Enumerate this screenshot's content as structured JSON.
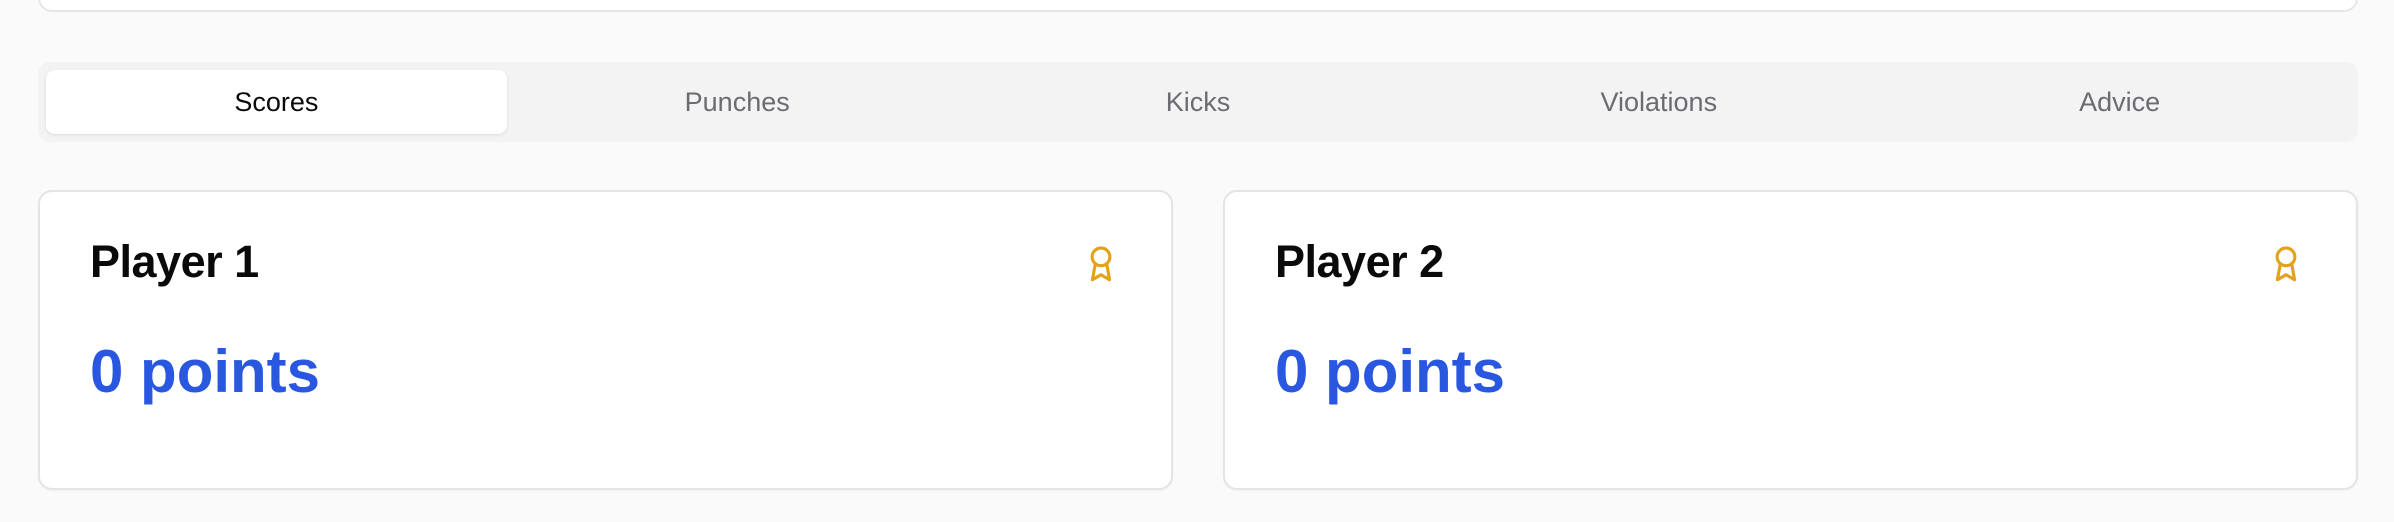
{
  "tabs": [
    {
      "label": "Scores",
      "active": true
    },
    {
      "label": "Punches",
      "active": false
    },
    {
      "label": "Kicks",
      "active": false
    },
    {
      "label": "Violations",
      "active": false
    },
    {
      "label": "Advice",
      "active": false
    }
  ],
  "players": [
    {
      "name": "Player 1",
      "points": "0 points",
      "icon": "award-icon"
    },
    {
      "name": "Player 2",
      "points": "0 points",
      "icon": "award-icon"
    }
  ],
  "colors": {
    "accent": "#2957e0",
    "award": "#e3a21a",
    "tab_bg": "#f3f3f4"
  }
}
